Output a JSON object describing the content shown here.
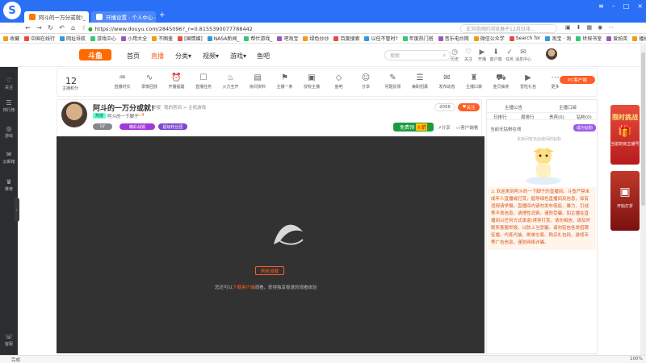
{
  "browser": {
    "tabs": [
      {
        "title": "阿斗的一万分或就!_"
      },
      {
        "title": "开播设置 - 个人中心 - 斗"
      }
    ],
    "url": "https://www.douyu.com/2845096?_r=0.8155390077788442",
    "search_placeholder": "正浏览网的浏览器于12月日冲…",
    "bookmarks": [
      "收藏",
      "中国在线行",
      "网址导航",
      "游戏中心",
      "小用大全",
      "不图鉴",
      "[国情媒]",
      "NASA新闻_",
      "帮忙游戏_",
      "吧淘宝",
      "绿色炒炒",
      "百度搜索",
      "以任不管时?",
      "年度热门搭",
      "音乐电台网",
      "微信公众学",
      "Search for",
      "淘宝 · 淘",
      "世探书室",
      "爱拍英",
      "播播管",
      "主播"
    ]
  },
  "site": {
    "logo": "斗鱼",
    "nav": [
      "首页",
      "直播",
      "分类▾",
      "视频▾",
      "游戏▾",
      "鱼吧"
    ],
    "search_placeholder": "搜索",
    "header_icons": [
      {
        "label": "历史",
        "icon": "history-icon"
      },
      {
        "label": "关注",
        "icon": "follow-icon"
      },
      {
        "label": "开播",
        "icon": "broadcast-icon"
      },
      {
        "label": "客户端",
        "icon": "download-icon"
      },
      {
        "label": "任务",
        "icon": "task-icon"
      },
      {
        "label": "消息中心",
        "icon": "message-icon"
      }
    ]
  },
  "leftbar": [
    {
      "label": "关注",
      "icon": "heart-icon"
    },
    {
      "label": "排行榜",
      "icon": "rank-icon"
    },
    {
      "label": "游戏",
      "icon": "game-icon"
    },
    {
      "label": "云邮箱",
      "icon": "mail-icon"
    },
    {
      "label": "推荐",
      "icon": "trophy-icon"
    },
    {
      "label": "客服",
      "icon": "service-icon"
    }
  ],
  "categories": {
    "count": "12",
    "items": [
      "主播积分",
      "直播时长",
      "录像回放",
      "开播提醒",
      "直播任务",
      "火力全开",
      "房间资料",
      "主播一条",
      "授权主播",
      "鱼吧",
      "分享",
      "问题反馈",
      "兼职招募",
      "发布动态",
      "主播口袋",
      "金贝抽奖",
      "冒险礼包",
      "更多"
    ],
    "pc_button": "PC客户端"
  },
  "room": {
    "title": "阿斗的一万分或就!",
    "report": "举报",
    "category": "我的房间 > 主机游戏",
    "streamer": "阿斗的一下脚子",
    "fans": "4",
    "level_badge": "精彩战狐",
    "badge2": "超级粉丝团",
    "follow_count": "2056",
    "follow_button": "关注",
    "share": "分享",
    "client_watch": "客户端看",
    "free_gift": "免费领",
    "gift_tag": "火箭",
    "hot_label": "热度"
  },
  "player": {
    "refresh_button": "刷新加载",
    "hint_prefix": "您还可以",
    "hint_link": "下载客户端",
    "hint_suffix": "观看，获得独享极速的观看体验"
  },
  "right": {
    "tabs_top": [
      "主播公告",
      "主播口袋"
    ],
    "tabs": [
      "日排行",
      "周排行",
      "贵宾(0)",
      "钻粉(0)"
    ],
    "rank_note": "当前无钻粉在线",
    "team_button": "成为钻粉",
    "empty_text": "本房间暂无此房间的钻粉",
    "notice": "欢迎来到阿斗的一下脚子的直播间。斗鱼严禁未成年人直播或打赏，倡导绿色直播间及信息，如有违规请举报。直播间内请勿发布低俗、暴力、引战等不良信息，请理性消费，谨防受骗。如主播在直播间以任何方式承诺/诱导打赏，请勿相信，请及时联系客服举报，以防上当受骗。请勿轻信各类招聘征婚、代练代抽、刷单交易、购买礼包码、游戏币等广告信息，谨防网络诈骗。"
  },
  "ads": [
    {
      "text": "限时挑战"
    },
    {
      "text": "当前的房主播号"
    },
    {
      "text": "开始打折"
    }
  ],
  "status": {
    "left": "完成",
    "zoom": "100%"
  }
}
